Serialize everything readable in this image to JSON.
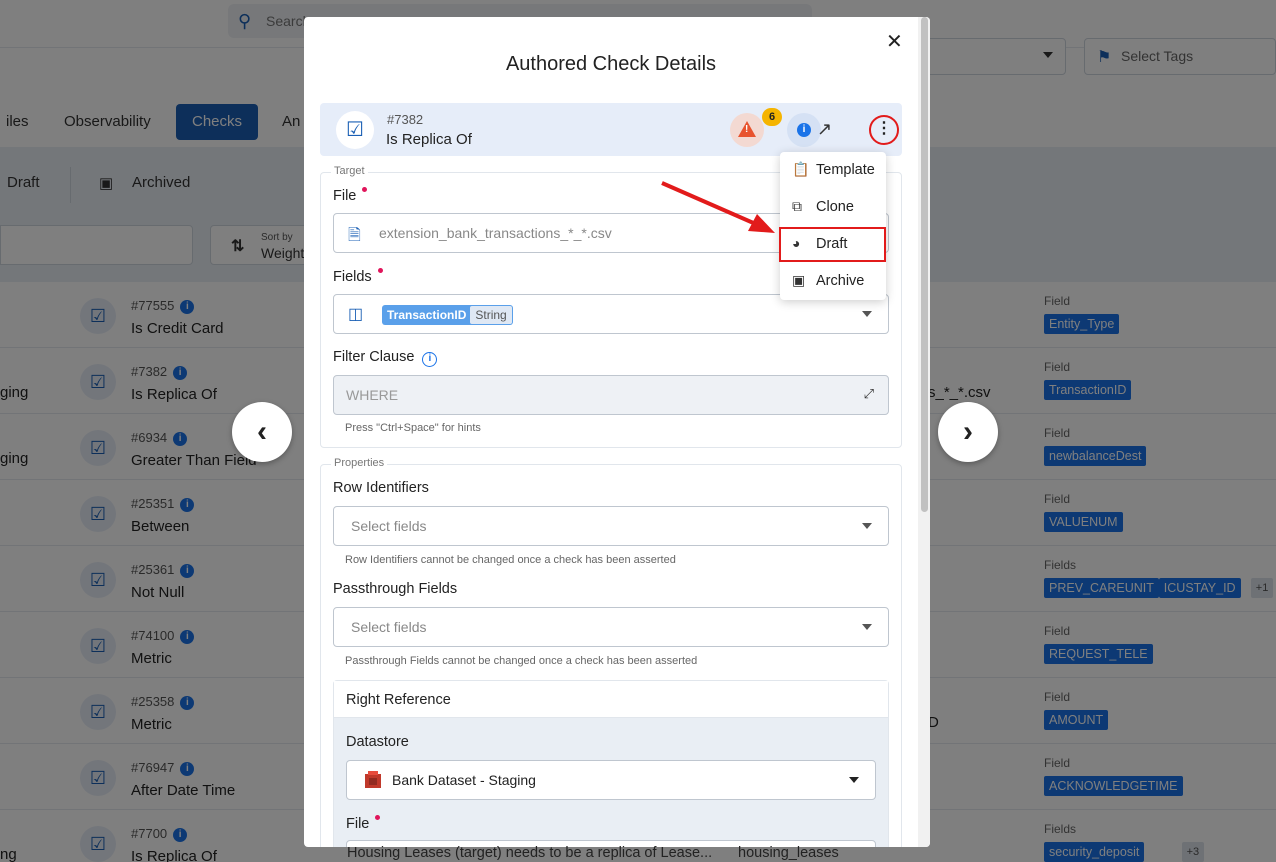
{
  "app": {
    "search_placeholder": "Search",
    "tag_select": "Select Tags",
    "tabs": [
      "iles",
      "Observability",
      "Checks",
      "An"
    ],
    "active_tab": "Checks",
    "filters": {
      "draft": "Draft",
      "archived": "Archived"
    },
    "sort": {
      "label": "Sort by",
      "value": "Weight"
    }
  },
  "list_rows": [
    {
      "num": "#77555",
      "name": "Is Credit Card",
      "left": "",
      "mid": "",
      "field_label": "Field",
      "fields": [
        "Entity_Type"
      ],
      "more": ""
    },
    {
      "num": "#7382",
      "name": "Is Replica Of",
      "left": "ging",
      "mid": "s_*_*.csv",
      "field_label": "Field",
      "fields": [
        "TransactionID"
      ],
      "more": ""
    },
    {
      "num": "#6934",
      "name": "Greater Than Field",
      "left": "ging",
      "mid": "",
      "field_label": "Field",
      "fields": [
        "newbalanceDest"
      ],
      "more": ""
    },
    {
      "num": "#25351",
      "name": "Between",
      "left": "",
      "mid": "",
      "field_label": "Field",
      "fields": [
        "VALUENUM"
      ],
      "more": ""
    },
    {
      "num": "#25361",
      "name": "Not Null",
      "left": "",
      "mid": "",
      "field_label": "Fields",
      "fields": [
        "PREV_CAREUNIT",
        "ICUSTAY_ID"
      ],
      "more": "+1"
    },
    {
      "num": "#74100",
      "name": "Metric",
      "left": "",
      "mid": "",
      "field_label": "Field",
      "fields": [
        "REQUEST_TELE"
      ],
      "more": ""
    },
    {
      "num": "#25358",
      "name": "Metric",
      "left": "",
      "mid": "D",
      "field_label": "Field",
      "fields": [
        "AMOUNT"
      ],
      "more": ""
    },
    {
      "num": "#76947",
      "name": "After Date Time",
      "left": "",
      "mid": "",
      "field_label": "Field",
      "fields": [
        "ACKNOWLEDGETIME"
      ],
      "more": ""
    },
    {
      "num": "#7700",
      "name": "Is Replica Of",
      "left": "ng",
      "mid": "",
      "field_label": "Fields",
      "fields": [
        "security_deposit"
      ],
      "more": "+3"
    }
  ],
  "modal": {
    "title": "Authored Check Details",
    "check_num": "#7382",
    "check_name": "Is Replica Of",
    "warning_count": "6",
    "target_legend": "Target",
    "file_label": "File",
    "file_value": "extension_bank_transactions_*_*.csv",
    "fields_label": "Fields",
    "field_chip": "TransactionID",
    "field_type": "String",
    "filter_label": "Filter Clause",
    "filter_placeholder": "WHERE",
    "filter_hint": "Press \"Ctrl+Space\" for hints",
    "properties_legend": "Properties",
    "row_id_label": "Row Identifiers",
    "row_id_placeholder": "Select fields",
    "row_id_hint": "Row Identifiers cannot be changed once a check has been asserted",
    "passthrough_label": "Passthrough Fields",
    "passthrough_placeholder": "Select fields",
    "passthrough_hint": "Passthrough Fields cannot be changed once a check has been asserted",
    "right_ref_label": "Right Reference",
    "datastore_label": "Datastore",
    "datastore_value": "Bank Dataset - Staging",
    "ref_file_label": "File",
    "bottom_left": "Housing Leases (target) needs to be a replica of Lease...",
    "bottom_right": "housing_leases"
  },
  "menu": {
    "items": [
      "Template",
      "Clone",
      "Draft",
      "Archive"
    ],
    "highlighted": "Draft"
  },
  "colors": {
    "accent": "#1a5fb4",
    "tag": "#1a73e8",
    "highlight": "#e21b1b"
  }
}
